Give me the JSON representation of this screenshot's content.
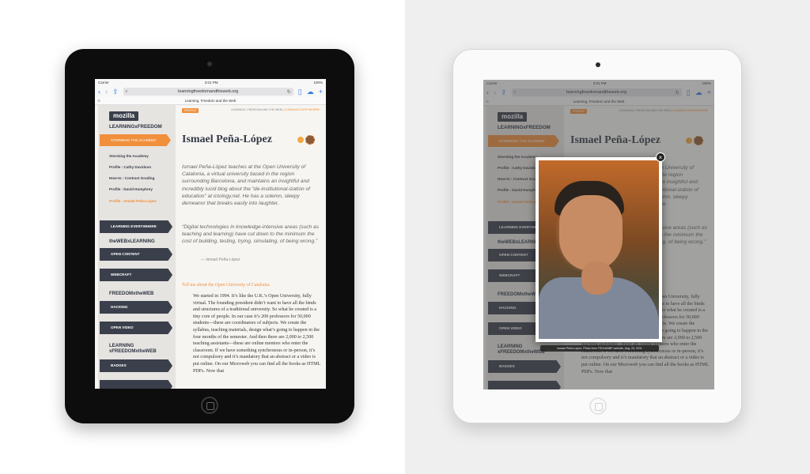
{
  "status": {
    "carrier": "Carrier",
    "time": "3:01 PM",
    "battery": "100%"
  },
  "browser": {
    "url": "learningfreedomandtheweb.org",
    "page_title": "Learning, Freedom and the Web"
  },
  "sidebar": {
    "logo": "mozilla",
    "heading": "LEARNINGxFREEDOM",
    "active_item": "STORMING THE ACADEMY",
    "links": [
      "Storming the Academy",
      "Profile : Cathy Davidson",
      "How-to : Contract Grading",
      "Profile : David Humphrey",
      "Profile : Ismael Peña-López"
    ],
    "learning_everywhere": "LEARNING EVERYWHERE",
    "web_learning_heading": "theWEBxLEARNING",
    "open_content": "OPEN CONTENT",
    "webcraft": "WEBCRAFT",
    "freedom_web_heading": "FREEDOMxtheWEB",
    "hacking": "HACKING",
    "open_video": "OPEN VIDEO",
    "learning_freedom_web_heading": "LEARNING xFREEDOMxtheWEB",
    "badges": "BADGES"
  },
  "article": {
    "tag": "PROFILE",
    "breadcrumb": "LEARNING, FREEDOM AND THE WEB",
    "breadcrumb_current": "LEARNING EVERYWHERE",
    "name": "Ismael Peña-López",
    "bio": "Ismael Peña-López teaches at the Open University of Catalonia, a virtual university based in the region surrounding Barcelona, and maintains an insightful and incredibly lucid blog about the “de-institutional-ization of education” at ictology.net. He has a solemn, sleepy demeanor that breaks easily into laughter.",
    "quote": "“Digital technologies in knowledge-intensive areas (such as teaching and learning) have cut down to the minimum the cost of building, testing, trying, simulating, of being wrong.”",
    "quote_by": "— Ismael Peña-López",
    "question": "Tell me about the Open University of Catalonia.",
    "body": "We started in 1994. It’s like the U.K.’s Open University, fully virtual. The founding president didn’t want to have all the binds and structures of a traditional university. So what he created is a tiny core of people. In our case it’s 200 professors for 50,000 students—these are coordinators of subjects. We create the syllabus, teaching materials, design what’s going to happen in the four months of the semester. And then there are 2,000 to 2,500 teaching assistants—these are online mentors who enter the classroom. If we have something synchronous or in-person, it’s not compulsory and it’s mandatory that an abstract or a video is put online. On our Microweb you can find all the books as HTML PDFs. Now that"
  },
  "lightbox": {
    "caption": "Ismael Peña-López. Photo from TEDxUNBP website, Aug. 20, 2011"
  },
  "colors": {
    "accent": "#f08f3c",
    "dark": "#3a3f4b"
  }
}
